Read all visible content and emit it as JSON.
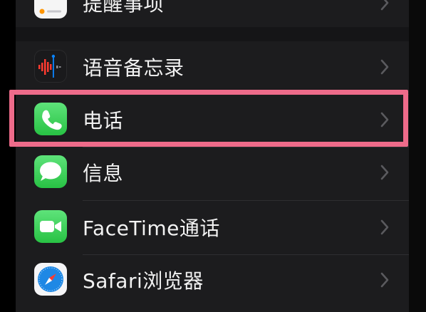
{
  "settings_list": {
    "items": [
      {
        "id": "reminders",
        "label": "提醒事项",
        "icon": "reminders-icon",
        "color": "#ffffff"
      },
      {
        "id": "voice-memos",
        "label": "语音备忘录",
        "icon": "voice-memos-icon",
        "color": "#1c1c1e"
      },
      {
        "id": "phone",
        "label": "电话",
        "icon": "phone-icon",
        "color": "#34c759"
      },
      {
        "id": "messages",
        "label": "信息",
        "icon": "messages-icon",
        "color": "#34c759"
      },
      {
        "id": "facetime",
        "label": "FaceTime通话",
        "icon": "facetime-icon",
        "color": "#34c759"
      },
      {
        "id": "safari",
        "label": "Safari浏览器",
        "icon": "safari-icon",
        "color": "#1e88e5"
      }
    ],
    "highlighted": "phone",
    "highlight_color": "#ee6b8a"
  }
}
